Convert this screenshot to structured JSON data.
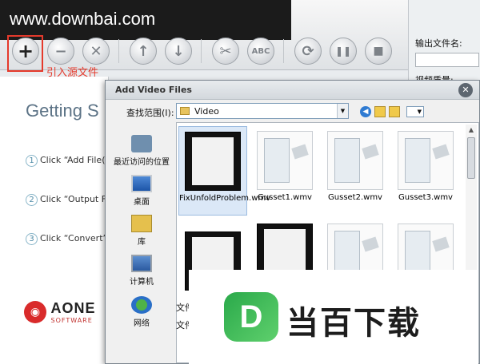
{
  "watermark": "www.downbai.com",
  "toolbar": {
    "add_caption": "引入源文件",
    "buttons": [
      {
        "name": "add-file-button",
        "glyph": "+"
      },
      {
        "name": "remove-button",
        "glyph": "−"
      },
      {
        "name": "clear-button",
        "glyph": "✕"
      },
      {
        "name": "move-up-button",
        "glyph": "↑"
      },
      {
        "name": "move-down-button",
        "glyph": "↓"
      },
      {
        "name": "cut-button",
        "glyph": "✂"
      },
      {
        "name": "rename-button",
        "glyph": "ABC"
      },
      {
        "name": "convert-button",
        "glyph": "⟳"
      },
      {
        "name": "pause-button",
        "glyph": "❚❚"
      },
      {
        "name": "stop-button",
        "glyph": "■"
      }
    ]
  },
  "right_panel": {
    "output_name_label": "输出文件名:",
    "video_quality_label": "视频质量:"
  },
  "getting_started": {
    "title": "Getting S",
    "steps": [
      {
        "num": "1",
        "text": "Click “Add File(s"
      },
      {
        "num": "2",
        "text": "Click “Output Fo"
      },
      {
        "num": "3",
        "text": "Click “Convert”"
      }
    ],
    "logo_text": "AONE",
    "logo_sub": "SOFTWARE"
  },
  "dialog": {
    "title": "Add Video Files",
    "look_in_label": "查找范围(I):",
    "look_in_value": "Video",
    "places": [
      "最近访问的位置",
      "桌面",
      "库",
      "计算机",
      "网络"
    ],
    "files": [
      {
        "name": "FixUnfoldProblem.wmv",
        "kind": "video",
        "selected": true
      },
      {
        "name": "Gusset1.wmv",
        "kind": "doc"
      },
      {
        "name": "Gusset2.wmv",
        "kind": "doc"
      },
      {
        "name": "Gusset3.wmv",
        "kind": "doc"
      },
      {
        "name": "",
        "kind": "video"
      },
      {
        "name": "",
        "kind": "video"
      },
      {
        "name": "",
        "kind": "doc"
      },
      {
        "name": "",
        "kind": "doc"
      }
    ],
    "filename_label": "文件",
    "filetype_label": "文件"
  },
  "brand": {
    "mark": "D",
    "text": "当百下载",
    "color": "#2aa94a"
  }
}
